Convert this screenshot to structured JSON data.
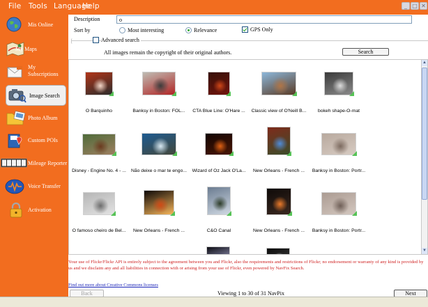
{
  "menu": [
    "File",
    "Tools",
    "Language",
    "Help"
  ],
  "sidebar": {
    "items": [
      {
        "label": "Mis Online",
        "icon": "globe-icon"
      },
      {
        "label": "My Maps",
        "icon": "map-icon"
      },
      {
        "label": "My Subscriptions",
        "line1": "My",
        "line2": "Subscriptions",
        "icon": "envelope-icon"
      },
      {
        "label": "Image Search",
        "icon": "camera-icon",
        "active": true
      },
      {
        "label": "Photo Album",
        "icon": "folder-icon"
      },
      {
        "label": "Custom POIs",
        "icon": "book-icon"
      },
      {
        "label": "Mileage Reporter",
        "icon": "odometer-icon"
      },
      {
        "label": "Voice Transfer",
        "icon": "audio-icon"
      },
      {
        "label": "Activation",
        "icon": "padlock-icon"
      }
    ]
  },
  "search": {
    "description_label": "Description",
    "description_value": "o",
    "sort_label": "Sort by",
    "sort_options": [
      "Most interesting",
      "Relevance"
    ],
    "sort_selected": "Relevance",
    "gps_label": "GPS Only",
    "gps_checked": true,
    "advanced_label": "Advanced search",
    "advanced_checked": false,
    "copyright": "All images remain the copyright of their original authors.",
    "search_button": "Search"
  },
  "results": [
    {
      "caption": "O Barquinho",
      "palette": [
        "#b03518",
        "#f3d7c8",
        "#2d2d2d"
      ],
      "gps": true
    },
    {
      "caption": "Banksy in Boston: FOL...",
      "palette": [
        "#bfbcb3",
        "#3c3c3c",
        "#b12626"
      ],
      "gps": true
    },
    {
      "caption": "CTA Blue Line: O'Hare ...",
      "palette": [
        "#371008",
        "#cf4718",
        "#71150d"
      ],
      "gps": true
    },
    {
      "caption": "Classic view of O'Neill B...",
      "palette": [
        "#8cb7da",
        "#b07546",
        "#5a3b25"
      ],
      "gps": true
    },
    {
      "caption": "bokeh shape-O-mat",
      "palette": [
        "#3a3a3a",
        "#dddddd",
        "#8a8a8a"
      ],
      "gps": true
    },
    {
      "caption": "Disney - Engine No. 4 - ...",
      "palette": [
        "#4f6b3a",
        "#6b3a1f",
        "#9e7f60"
      ],
      "gps": true
    },
    {
      "caption": "Não deixe o mar te engo...",
      "palette": [
        "#1d5b91",
        "#d8e9f2",
        "#44483b"
      ],
      "gps": true
    },
    {
      "caption": "Wizard of Oz Jack O'La...",
      "palette": [
        "#120402",
        "#e06113",
        "#4a1705"
      ],
      "gps": true
    },
    {
      "caption": "New Orleans - French ...",
      "palette": [
        "#7f2b1b",
        "#4f8cd8",
        "#3b4d2b"
      ],
      "gps": true
    },
    {
      "caption": "Banksy in Boston: Portr...",
      "palette": [
        "#b8a99e",
        "#7c6a5f",
        "#d7cbc2"
      ],
      "gps": true
    },
    {
      "caption": "O famoso cheiro de Bel...",
      "palette": [
        "#b6b6b6",
        "#6c6c6c",
        "#e2e2e2"
      ],
      "gps": true
    },
    {
      "caption": "New Orleans - French ...",
      "palette": [
        "#0d0908",
        "#d04a15",
        "#f6b55a"
      ],
      "gps": true
    },
    {
      "caption": "C&O Canal",
      "palette": [
        "#6b7c91",
        "#2c3b28",
        "#cfd8e2"
      ],
      "gps": true
    },
    {
      "caption": "New Orleans - French ...",
      "palette": [
        "#0e0a08",
        "#eb7a2a",
        "#3a2820"
      ],
      "gps": true
    },
    {
      "caption": "Banksy in Boston: Portr...",
      "palette": [
        "#ab9b92",
        "#6f5f57",
        "#d3c7bf"
      ],
      "gps": true
    },
    {
      "caption": "",
      "palette": [
        "#c8bcb0",
        "#7a4b2c",
        "#e6ddd3"
      ],
      "gps": false
    },
    {
      "caption": "",
      "palette": [
        "#9a7d72",
        "#5c4038",
        "#c2aaa0"
      ],
      "gps": false
    },
    {
      "caption": "",
      "palette": [
        "#0d0d14",
        "#3b3b60",
        "#b0b0d8"
      ],
      "gps": false
    },
    {
      "caption": "",
      "palette": [
        "#0a0a0a",
        "#f2f2f2",
        "#444444"
      ],
      "gps": false
    },
    {
      "caption": "",
      "palette": [
        "#b8a49c",
        "#7e6b63",
        "#ddd0c8"
      ],
      "gps": false
    }
  ],
  "notice": "Your use of Flickr/Flickr API is entirely subject to the agreement between you and Flickr, also the requirements and restrictions of Flickr; no endorsement or warranty of any kind is provided by us and we disclaim any and all liabilities in connection with or arising from your use of Flickr, even powered by NavFix Search.",
  "cc_link": "Find out more about Creative Commons licenses",
  "pagination": {
    "back_label": "Back",
    "status": "Viewing 1 to 30 of 31 NavPix",
    "next_label": "Next"
  },
  "colors": {
    "accent": "#f26d1f",
    "notice": "#cf1f1f",
    "link": "#1a24b8"
  }
}
